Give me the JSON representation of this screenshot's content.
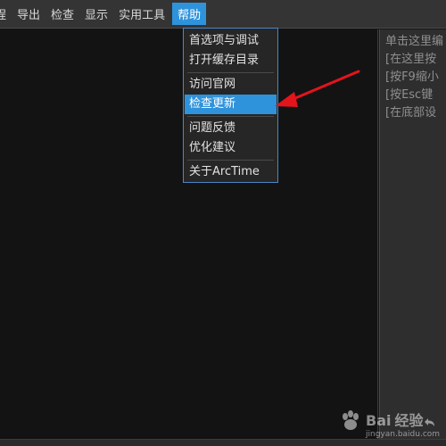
{
  "menubar": {
    "items": [
      {
        "label": "程"
      },
      {
        "label": "导出"
      },
      {
        "label": "检查"
      },
      {
        "label": "显示"
      },
      {
        "label": "实用工具"
      },
      {
        "label": "帮助"
      }
    ]
  },
  "help_menu": {
    "items": [
      {
        "label": "首选项与调试"
      },
      {
        "label": "打开缓存目录"
      },
      {
        "label": "访问官网"
      },
      {
        "label": "检查更新"
      },
      {
        "label": "问题反馈"
      },
      {
        "label": "优化建议"
      },
      {
        "label": "关于ArcTime"
      }
    ]
  },
  "right_panel": {
    "lines": [
      "单击这里编",
      "[在这里按",
      "[按F9缩小",
      "[按Esc键",
      "[在底部设"
    ]
  },
  "watermark": {
    "text": "经验",
    "sub": "jingyan.baidu.com",
    "brand": "Bai"
  },
  "colors": {
    "accent": "#2f93dc",
    "annotation_arrow": "#e3141c"
  }
}
